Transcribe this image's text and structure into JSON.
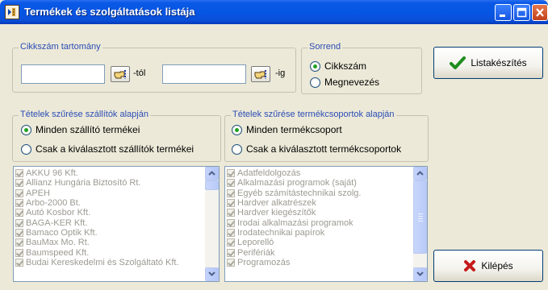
{
  "window": {
    "title": "Termékek és szolgáltatások listája",
    "buttons": [
      "minimize",
      "maximize",
      "close"
    ]
  },
  "range": {
    "label": "Cikkszám tartomány",
    "from_value": "",
    "from_suffix": "-tól",
    "to_value": "",
    "to_suffix": "-ig"
  },
  "sort": {
    "label": "Sorrend",
    "options": [
      {
        "label": "Cikkszám",
        "checked": true
      },
      {
        "label": "Megnevezés",
        "checked": false
      }
    ]
  },
  "supplier_filter": {
    "label": "Tételek szűrése szállítók alapján",
    "options": [
      {
        "label": "Minden szállító termékei",
        "checked": true
      },
      {
        "label": "Csak a kiválasztott szállítók termékei",
        "checked": false
      }
    ],
    "items": [
      "AKKU 96 Kft.",
      "Allianz Hungária Biztosító Rt.",
      "APEH",
      "Arbo-2000 Bt.",
      "Autó Kosbor Kft.",
      "BAGA-KER Kft.",
      "Bamaco Optik Kft.",
      "BauMax Mo. Rt.",
      "Baumspeed Kft.",
      "Budai Kereskedelmi és Szolgáltató Kft."
    ]
  },
  "group_filter": {
    "label": "Tételek szűrése termékcsoportok alapján",
    "options": [
      {
        "label": "Minden termékcsoport",
        "checked": true
      },
      {
        "label": "Csak a kiválasztott termékcsoportok",
        "checked": false
      }
    ],
    "items": [
      "Adatfeldolgozás",
      "Alkalmazási programok (saját)",
      "Egyéb számítástechnikai szolg.",
      "Hardver alkatrészek",
      "Hardver kiegészítők",
      "Irodai alkalmazási programok",
      "Irodatechnikai papírok",
      "Leporelló",
      "Perifériák",
      "Programozás"
    ]
  },
  "actions": {
    "report_label": "Listakészítés",
    "exit_label": "Kilépés"
  },
  "icons": {
    "app": "list-app-icon",
    "lookup": "lookup-hand-icon",
    "report": "green-check-icon",
    "exit": "red-x-icon"
  },
  "colors": {
    "titlebar": "#0656e4",
    "group_label": "#2b4db5",
    "window_bg": "#ece9d8",
    "disabled_text": "#9c9a92"
  }
}
